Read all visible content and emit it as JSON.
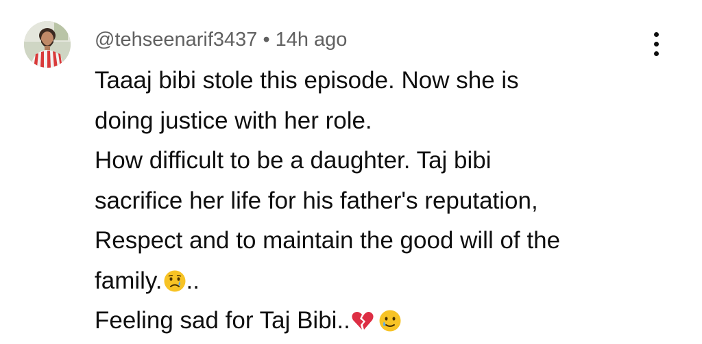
{
  "comment": {
    "author": "@tehseenarif3437",
    "separator": "•",
    "timestamp": "14h ago",
    "avatar_icon": "user-avatar",
    "menu_icon": "more-vert-icon",
    "lines": [
      "Taaaj bibi stole this episode. Now she is",
      "doing justice with her role.",
      "How difficult to be a daughter. Taj bibi",
      "sacrifice her life for his father's reputation,",
      "Respect and to maintain the good will of the",
      "family."
    ],
    "line6_suffix": "..",
    "line7_text": "Feeling sad for Taj Bibi..",
    "emojis": {
      "crying": "😢",
      "broken_heart": "💔",
      "smiling_tear": "🥲"
    },
    "colors": {
      "meta_text": "#606060",
      "body_text": "#0f0f0f",
      "background": "#ffffff",
      "emoji_yellow": "#f7c325",
      "broken_heart_red": "#dd2e44"
    }
  }
}
